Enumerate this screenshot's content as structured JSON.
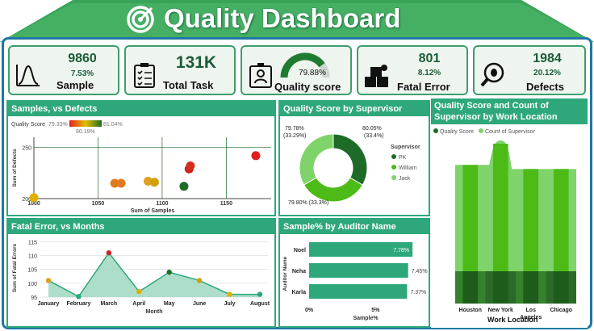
{
  "header": {
    "title": "Quality Dashboard"
  },
  "kpis": {
    "sample": {
      "value": "9860",
      "sub": "7.53%",
      "label": "Sample"
    },
    "total_task": {
      "value": "131K",
      "label": "Total Task"
    },
    "quality_score": {
      "value": "79.88%",
      "label": "Quality score",
      "gauge_fraction": 0.7988
    },
    "fatal_error": {
      "value": "801",
      "sub": "8.12%",
      "label": "Fatal Error"
    },
    "defects": {
      "value": "1984",
      "sub": "20.12%",
      "label": "Defects"
    }
  },
  "samples_panel": {
    "title": "Samples, vs Defects",
    "legend_label": "Quality Score",
    "legend_min": "79.33%",
    "legend_mid": "80.19%",
    "legend_max": "81.04%"
  },
  "supervisor_panel": {
    "title": "Quality Score by Supervisor",
    "legend_title": "Supervisor",
    "label_top_left_1": "79.78%",
    "label_top_left_2": "(33.29%)",
    "label_top_right_1": "80.05%",
    "label_top_right_2": "(33.4%)",
    "label_bottom": "79.80% (33.3%)"
  },
  "location_panel": {
    "title_line1": "Quality Score and Count of",
    "title_line2": "Supervisor by Work Location",
    "legend_a": "Quality Score",
    "legend_b": "Count of Supervisor",
    "xlabel": "Work Location"
  },
  "fatal_panel": {
    "title": "Fatal Error, vs Months"
  },
  "auditor_panel": {
    "title": "Sample% by Auditor Name"
  },
  "colors": {
    "green_dark": "#1a5c36",
    "panel_green": "#2ea87a",
    "light_green": "#7fd36b",
    "mid_green": "#4cbb17",
    "dark_green": "#1e6b27",
    "frame_blue": "#1f78a4"
  },
  "chart_data": [
    {
      "type": "scatter",
      "title": "Samples, vs Defects",
      "xlabel": "Sum of Samples",
      "ylabel": "Sum of Defects",
      "xlim": [
        1000,
        1185
      ],
      "ylim": [
        200,
        260
      ],
      "xticks": [
        "1000",
        "1050",
        "1100",
        "1150"
      ],
      "yticks": [
        "200",
        "250"
      ],
      "points": [
        {
          "x": 1000,
          "y": 201,
          "color": "#e0b000"
        },
        {
          "x": 1063,
          "y": 215,
          "color": "#e07a20"
        },
        {
          "x": 1068,
          "y": 215,
          "color": "#e07a20"
        },
        {
          "x": 1089,
          "y": 217,
          "color": "#e0a020"
        },
        {
          "x": 1094,
          "y": 216,
          "color": "#d4a000"
        },
        {
          "x": 1117,
          "y": 212,
          "color": "#1e6b27"
        },
        {
          "x": 1121,
          "y": 229,
          "color": "#d02020"
        },
        {
          "x": 1122,
          "y": 232,
          "color": "#d03020"
        },
        {
          "x": 1173,
          "y": 242,
          "color": "#e02020"
        }
      ]
    },
    {
      "type": "pie",
      "title": "Quality Score by Supervisor",
      "series": [
        {
          "name": "PK",
          "value": 33.4,
          "color": "#1e6b27"
        },
        {
          "name": "William",
          "value": 33.29,
          "color": "#4cbb17"
        },
        {
          "name": "Jack",
          "value": 33.3,
          "color": "#7fd36b"
        }
      ]
    },
    {
      "type": "area",
      "title": "Quality Score and Count of Supervisor by Work Location",
      "categories": [
        "Houston",
        "New York",
        "Los Angeles",
        "Chicago"
      ],
      "series": [
        {
          "name": "Quality Score",
          "values": [
            34,
            38,
            33,
            33
          ]
        },
        {
          "name": "Count of Supervisor",
          "values": [
            34,
            38,
            33,
            33
          ]
        }
      ]
    },
    {
      "type": "area",
      "title": "Fatal Error, vs Months",
      "xlabel": "Month",
      "ylabel": "Sum of Fatal Errors",
      "categories": [
        "January",
        "February",
        "March",
        "April",
        "May",
        "June",
        "July",
        "August"
      ],
      "ylim": [
        95,
        116
      ],
      "yticks": [
        "95",
        "100",
        "105",
        "110",
        "115"
      ],
      "values": [
        101,
        95.2,
        111,
        97,
        104,
        101,
        96,
        96
      ],
      "point_colors": [
        "#e0a020",
        "#2ea87a",
        "#d02020",
        "#e0b000",
        "#1e6b27",
        "#d4a000",
        "#e0b000",
        "#2ea87a"
      ]
    },
    {
      "type": "bar",
      "title": "Sample% by Auditor Name",
      "xlabel": "Sample%",
      "ylabel": "Auditor Name",
      "categories": [
        "Noel",
        "Neha",
        "Karla"
      ],
      "values": [
        7.78,
        7.45,
        7.37
      ],
      "value_labels": [
        "7.78%",
        "7.45%",
        "7.37%"
      ],
      "xticks": [
        "0%",
        "5%"
      ],
      "xlim": [
        0,
        8.5
      ]
    }
  ]
}
